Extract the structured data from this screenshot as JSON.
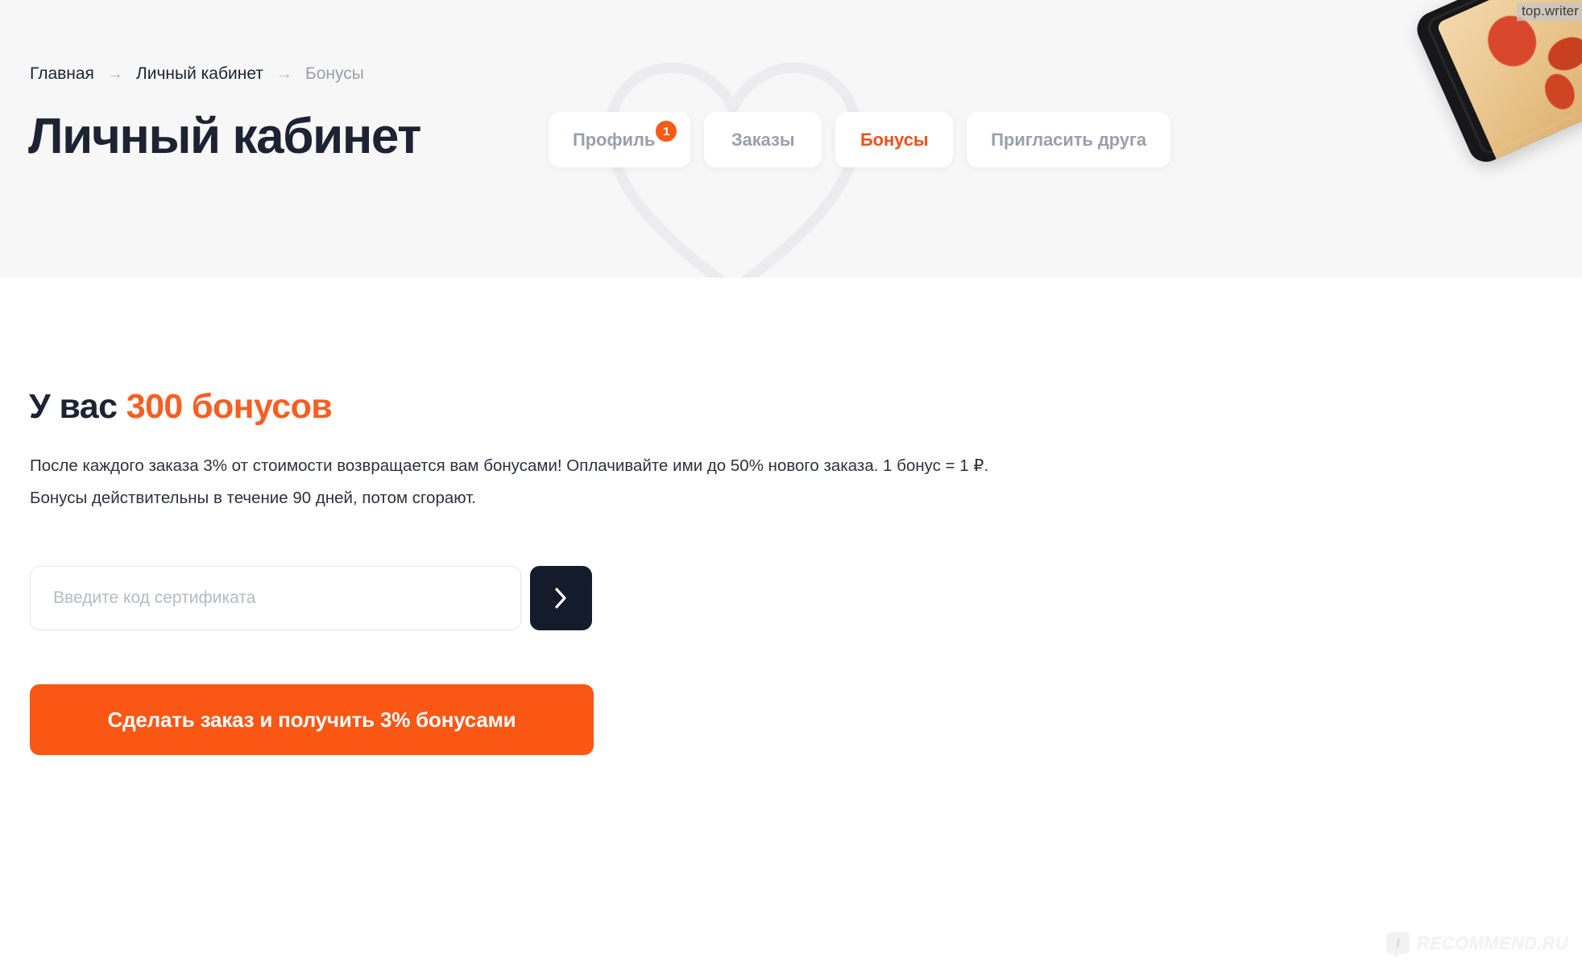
{
  "breadcrumb": {
    "items": [
      {
        "label": "Главная",
        "current": false
      },
      {
        "label": "Личный кабинет",
        "current": false
      },
      {
        "label": "Бонусы",
        "current": true
      }
    ],
    "separator": "→"
  },
  "header": {
    "title": "Личный кабинет",
    "tabs": [
      {
        "label": "Профиль",
        "active": false,
        "badge": "1"
      },
      {
        "label": "Заказы",
        "active": false,
        "badge": ""
      },
      {
        "label": "Бонусы",
        "active": true,
        "badge": ""
      },
      {
        "label": "Пригласить друга",
        "active": false,
        "badge": ""
      }
    ]
  },
  "bonuses": {
    "heading_prefix": "У вас ",
    "heading_amount": "300 бонусов",
    "description_line1": "После каждого заказа 3% от стоимости возвращается вам бонусами! Оплачивайте ими до 50% нового заказа. 1 бонус = 1 ₽.",
    "description_line2": "Бонусы действительны в течение 90 дней, потом сгорают."
  },
  "certificate": {
    "placeholder": "Введите код сертификата",
    "value": "",
    "submit_icon": "chevron-right-icon"
  },
  "cta": {
    "label": "Сделать заказ и получить 3% бонусами"
  },
  "watermarks": {
    "top_right": "top.writer",
    "bottom_right_mark": "I",
    "bottom_right_text": "RECOMMEND.RU"
  },
  "colors": {
    "accent_orange": "#f75e22",
    "cta_orange": "#fa5614",
    "badge_orange": "#fa5a14",
    "dark": "#1d2333",
    "submit_dark": "#141b2b",
    "muted": "#9aa0ab",
    "header_bg": "#f7f7f8"
  }
}
